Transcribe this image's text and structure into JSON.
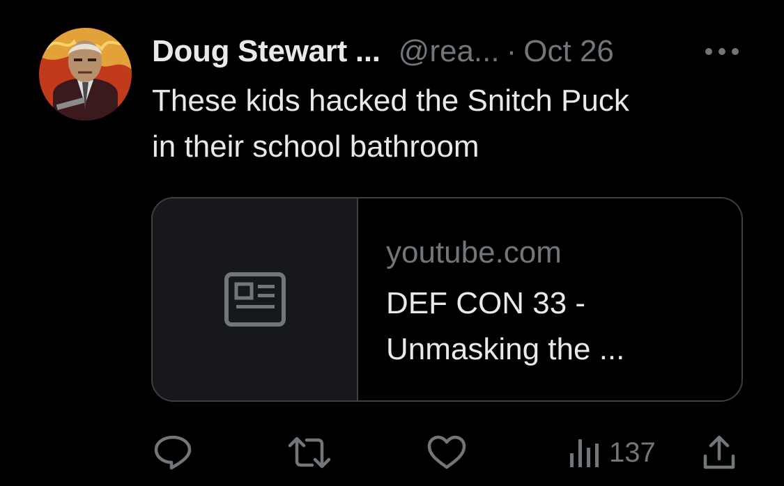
{
  "tweet": {
    "display_name": "Doug Stewart ...",
    "handle": "@rea...",
    "separator": "·",
    "date": "Oct 26",
    "text_line1": "These kids hacked the Snitch Puck",
    "text_line2": "in their school bathroom"
  },
  "card": {
    "domain": "youtube.com",
    "title_line1": "DEF CON 33 -",
    "title_line2": "Unmasking the ...",
    "thumb_icon": "article-icon"
  },
  "actions": {
    "reply_icon": "reply-icon",
    "retweet_icon": "retweet-icon",
    "like_icon": "heart-icon",
    "views_icon": "views-chart-icon",
    "views_count": "137",
    "share_icon": "share-icon"
  },
  "colors": {
    "background": "#000000",
    "primary_text": "#e7e9ea",
    "secondary_text": "#71767b",
    "card_border": "#3d4145",
    "card_thumb_bg": "#16181c"
  }
}
